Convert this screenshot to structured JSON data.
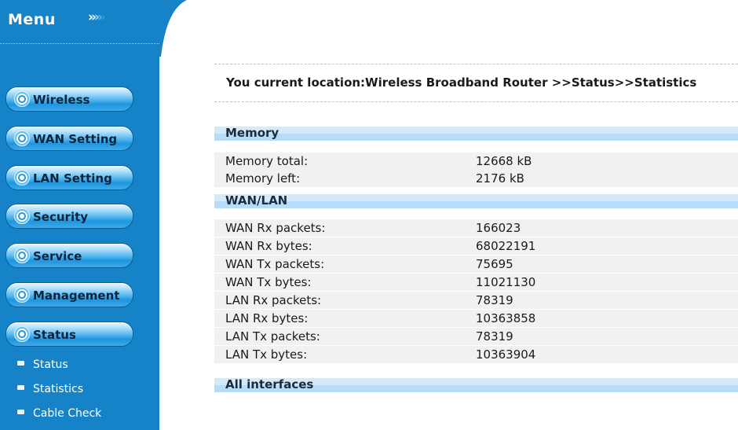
{
  "menu": {
    "title": "Menu",
    "arrows": "››››",
    "buttons": [
      {
        "label": "Wireless"
      },
      {
        "label": "WAN Setting"
      },
      {
        "label": "LAN Setting"
      },
      {
        "label": "Security"
      },
      {
        "label": "Service"
      },
      {
        "label": "Management"
      },
      {
        "label": "Status"
      }
    ],
    "sub_items": [
      {
        "label": "Status"
      },
      {
        "label": "Statistics"
      },
      {
        "label": "Cable Check"
      }
    ]
  },
  "breadcrumb": {
    "text": "You current location:Wireless Broadband Router >>Status>>Statistics"
  },
  "sections": [
    {
      "title": "Memory",
      "rows": [
        {
          "label": "Memory total:",
          "value": "12668 kB"
        },
        {
          "label": "Memory left:",
          "value": "2176 kB"
        }
      ]
    },
    {
      "title": "WAN/LAN",
      "rows": [
        {
          "label": "WAN Rx packets:",
          "value": "166023"
        },
        {
          "label": "WAN Rx bytes:",
          "value": "68022191"
        },
        {
          "label": "WAN Tx packets:",
          "value": "75695"
        },
        {
          "label": "WAN Tx bytes:",
          "value": "11021130"
        },
        {
          "label": "LAN Rx packets:",
          "value": "78319"
        },
        {
          "label": "LAN Rx bytes:",
          "value": "10363858"
        },
        {
          "label": "LAN Tx packets:",
          "value": "78319"
        },
        {
          "label": "LAN Tx bytes:",
          "value": "10363904"
        }
      ]
    },
    {
      "title": "All interfaces",
      "rows": []
    }
  ],
  "colors": {
    "sidebar_bg": "#1683c8",
    "section_header": "#b6dcf8",
    "row_bg": "#f1f1f1"
  }
}
